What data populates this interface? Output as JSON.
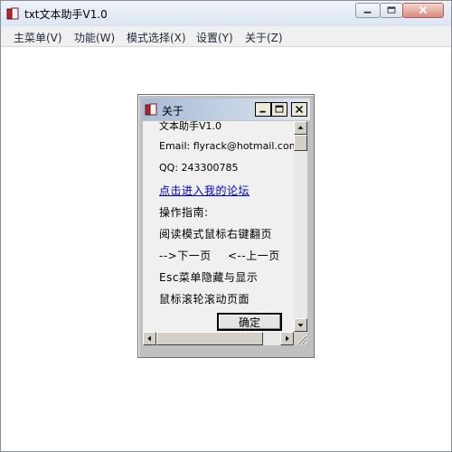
{
  "window": {
    "title": "txt文本助手V1.0"
  },
  "menu": [
    {
      "label": "主菜单(V)"
    },
    {
      "label": "功能(W)"
    },
    {
      "label": "模式选择(X)"
    },
    {
      "label": "设置(Y)"
    },
    {
      "label": "关于(Z)"
    }
  ],
  "about_dialog": {
    "title": "关于",
    "lines": {
      "app_name": "文本助手V1.0",
      "email": "Email:  flyrack@hotmail.com",
      "qq": "QQ:  243300785",
      "forum_link": "点击进入我的论坛",
      "guide_heading": "操作指南:",
      "guide_1": "阅读模式鼠标右键翻页",
      "guide_2_next": "-->下一页",
      "guide_2_prev": "<--上一页",
      "guide_3": "Esc菜单隐藏与显示",
      "guide_4": "鼠标滚轮滚动页面"
    },
    "ok_label": "确定"
  },
  "icons": {
    "app": "book-icon",
    "minimize": "minimize-icon",
    "maximize": "maximize-icon",
    "close": "close-icon",
    "dialog": "book-icon",
    "scroll_up": "arrow-up-icon",
    "scroll_down": "arrow-down-icon",
    "scroll_left": "arrow-left-icon",
    "scroll_right": "arrow-right-icon",
    "resize_grip": "resize-grip-icon"
  },
  "colors": {
    "link": "#0000cc",
    "dialog_bg": "#c0c0c0",
    "title_close": "#d98a7d"
  }
}
